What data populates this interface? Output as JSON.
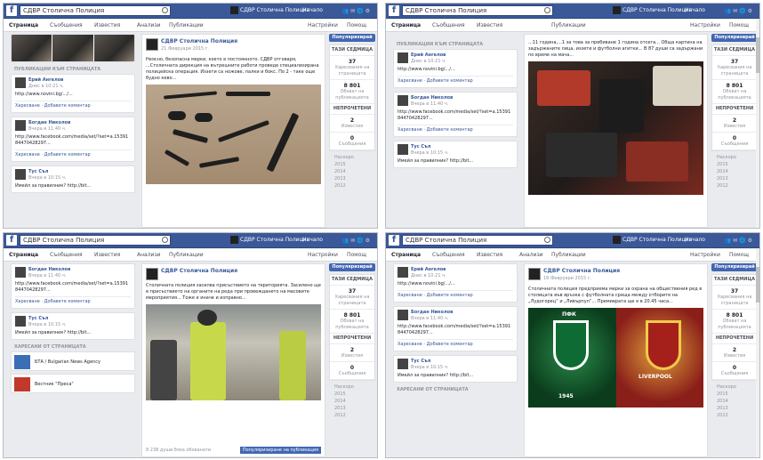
{
  "page_name": "СДВР Столична Полиция",
  "search_value": "СДВР Столична Полиция",
  "home": "Начало",
  "tabs": {
    "page": "Страница",
    "messages": "Съобщения",
    "notifications": "Известия",
    "insights": "Анализи",
    "publishing": "Публикации",
    "settings": "Настройки",
    "help": "Помощ"
  },
  "promote": "Популяризирай",
  "stats": {
    "this_week": "ТАЗИ СЕДМИЦА",
    "new_likes": "37",
    "new_likes_label": "Харесвания на страницата",
    "reach": "8 801",
    "reach_label": "Обхват на публикацията",
    "unread": "НЕПРОЧЕТЕНИ",
    "notif": "2",
    "notif_label": "Известия",
    "msgs": "0",
    "msgs_label": "Съобщения"
  },
  "years": [
    "Наскоро",
    "2015",
    "2014",
    "2013",
    "2012"
  ],
  "sections": {
    "posts_to_page": "ПУБЛИКАЦИИ КЪМ СТРАНИЦАТА",
    "liked_by_page": "ХАРЕСАНИ ОТ СТРАНИЦАТА"
  },
  "mini_posts": [
    {
      "name": "Ерий Ангелов",
      "date": "Днес в 10:21 ч.",
      "text": "http://www.novini.bg/.../...",
      "foot_like": "Харесване",
      "foot_comment": "Добавете коментар"
    },
    {
      "name": "Богдан Николов",
      "date": "Вчера в 11:40 ч.",
      "text": "http://www.facebook.com/media/set/?set=a.1539184470428297...",
      "foot_like": "Харесване",
      "foot_comment": "Добавете коментар"
    },
    {
      "name": "Тус Съл",
      "date": "Вчера в 10:15 ч.",
      "text": "Имейл за правилник? http://bit...",
      "foot_like": "Харесване",
      "foot_comment": "Добавете коментар"
    }
  ],
  "news_items": [
    "БТА / Bulgarian News Agency",
    "Вестник \"Преса\""
  ],
  "share_button": "Популяризиране на публикация",
  "post_stats": "8 238 души бяха обхванати",
  "quadrants": [
    {
      "date": "21 Февруари 2015 г.",
      "body": "Неясно, безопасна мерки, което е постоянното. СДВР отговаря, ...Столичната дирекция на вътрешните работи проведе специализирана полицейска операция. Иззети са ножове, палки и бокс. По 2 - таке още будно кево..."
    },
    {
      "date": "",
      "body": "...11 година,...1 за това за пребиване 1 година отсега... Обща картина на задържаните лица, иззети и футболни агитки... В 87 души са задържани по време на мача..."
    },
    {
      "date": "",
      "body": "Столичната полиция засилва присъствието на територията. Засилено ще е присъствието на органите на реда при провеждането на масовите мероприятия... Тоже е иначе и изправно..."
    },
    {
      "date": "18 Февруари 2015 г.",
      "body": "Столичната полиция предприема мерки за охрана на обществения ред в столицата във връзка с футболната среща между отборите на „Лудогорец“ и „Ливърпул“... Премиерата ще е в 20.45 часа..."
    }
  ],
  "liverpool_label": "LIVERPOOL",
  "pfk_label": "ПФК",
  "year_1945": "1945"
}
